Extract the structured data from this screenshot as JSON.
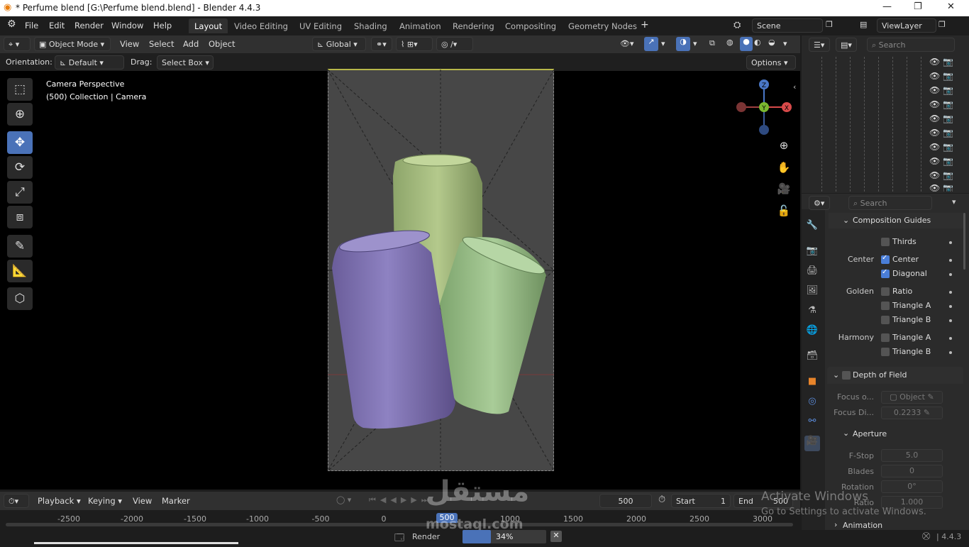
{
  "window": {
    "title": "* Perfume blend [G:\\Perfume blend.blend] - Blender 4.4.3",
    "minimize": "—",
    "maximize": "❐",
    "close": "✕"
  },
  "menu": {
    "items": [
      "File",
      "Edit",
      "Render",
      "Window",
      "Help"
    ]
  },
  "workspaces": [
    "Layout",
    "Video Editing",
    "UV Editing",
    "Shading",
    "Animation",
    "Rendering",
    "Compositing",
    "Geometry Nodes"
  ],
  "workspace_add": "+",
  "scene": {
    "name": "Scene",
    "view_layer": "ViewLayer"
  },
  "header3d": {
    "mode": "Object Mode",
    "menus": [
      "View",
      "Select",
      "Add",
      "Object"
    ],
    "transform": "Global"
  },
  "tool_settings": {
    "orientation_label": "Orientation:",
    "orientation_value": "Default",
    "drag_label": "Drag:",
    "drag_value": "Select Box",
    "options": "Options"
  },
  "viewport": {
    "info_line1": "Camera Perspective",
    "info_line2": "(500) Collection | Camera",
    "gizmo": {
      "z": "Z",
      "y": "Y",
      "x": "X"
    }
  },
  "outliner": {
    "search_placeholder": "Search",
    "rows": 10
  },
  "properties": {
    "search_placeholder": "Search",
    "composition_guides": "Composition Guides",
    "thirds": "Thirds",
    "center_label": "Center",
    "center": "Center",
    "diagonal": "Diagonal",
    "golden_label": "Golden",
    "ratio": "Ratio",
    "triangle_a": "Triangle A",
    "triangle_b": "Triangle B",
    "harmony_label": "Harmony",
    "harmony_triangle_a": "Triangle A",
    "harmony_triangle_b": "Triangle B",
    "depth_of_field": "Depth of Field",
    "focus_object_label": "Focus o...",
    "focus_object_value": "Object",
    "focus_distance_label": "Focus Di...",
    "focus_distance_value": "0.2233",
    "aperture": "Aperture",
    "fstop_label": "F-Stop",
    "fstop_value": "5.0",
    "blades_label": "Blades",
    "blades_value": "0",
    "rotation_label": "Rotation",
    "rotation_value": "0°",
    "ratio_label": "Ratio",
    "ratio_value": "1.000",
    "animation": "Animation"
  },
  "timeline": {
    "menus": [
      "Playback",
      "Keying",
      "View",
      "Marker"
    ],
    "current_frame": "500",
    "start_label": "Start",
    "start_value": "1",
    "end_label": "End",
    "end_value": "500",
    "ticks": [
      "-2500",
      "-2000",
      "-1500",
      "-1000",
      "-500",
      "0",
      "500",
      "1000",
      "1500",
      "2000",
      "2500",
      "3000"
    ],
    "playhead": "500"
  },
  "status": {
    "render_label": "Render",
    "progress_text": "34%",
    "progress": 0.34,
    "version": "4.4.3"
  },
  "watermark": {
    "activate": "Activate Windows",
    "goto": "Go to Settings to activate Windows.",
    "logo_ar": "مستقل",
    "logo_en": "mostaql.com"
  }
}
